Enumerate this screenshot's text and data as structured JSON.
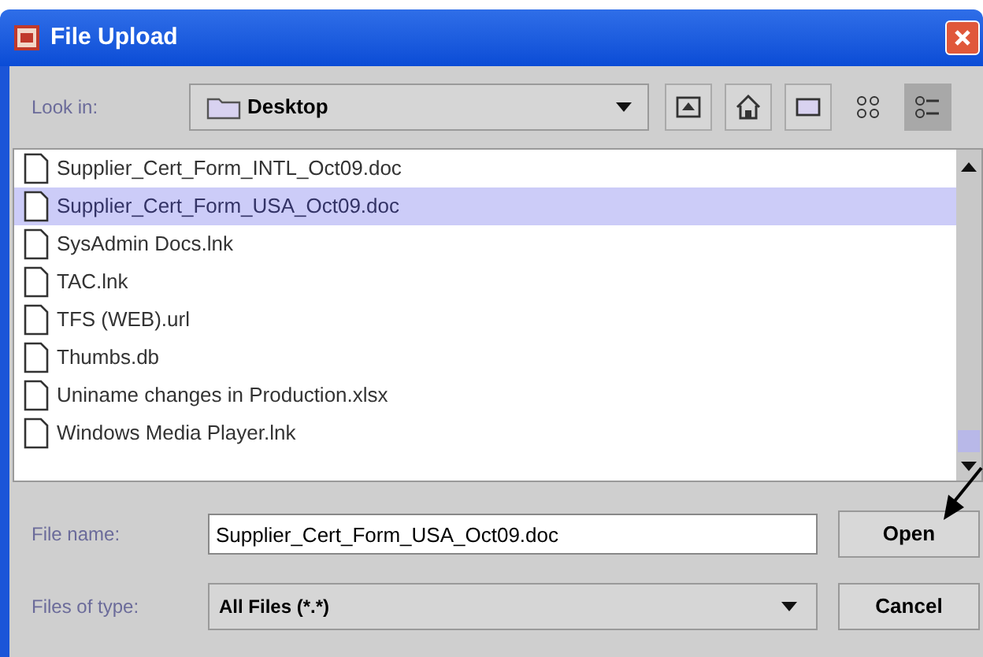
{
  "window": {
    "title": "File Upload"
  },
  "look_in": {
    "label": "Look in:",
    "value": "Desktop"
  },
  "toolbar": [
    {
      "kind": "up"
    },
    {
      "kind": "home"
    },
    {
      "kind": "new-folder"
    },
    {
      "kind": "list",
      "selected": false
    },
    {
      "kind": "details",
      "selected": true
    }
  ],
  "files": [
    {
      "name": "Supplier_Cert_Form_INTL_Oct09.doc",
      "selected": false
    },
    {
      "name": "Supplier_Cert_Form_USA_Oct09.doc",
      "selected": true
    },
    {
      "name": "SysAdmin Docs.lnk",
      "selected": false
    },
    {
      "name": "TAC.lnk",
      "selected": false
    },
    {
      "name": "TFS (WEB).url",
      "selected": false
    },
    {
      "name": "Thumbs.db",
      "selected": false
    },
    {
      "name": "Uniname changes in Production.xlsx",
      "selected": false
    },
    {
      "name": "Windows Media Player.lnk",
      "selected": false
    }
  ],
  "file_name": {
    "label": "File name:",
    "value": "Supplier_Cert_Form_USA_Oct09.doc"
  },
  "file_type": {
    "label": "Files of type:",
    "value": "All Files (*.*)"
  },
  "buttons": [
    "Open",
    "Cancel"
  ]
}
